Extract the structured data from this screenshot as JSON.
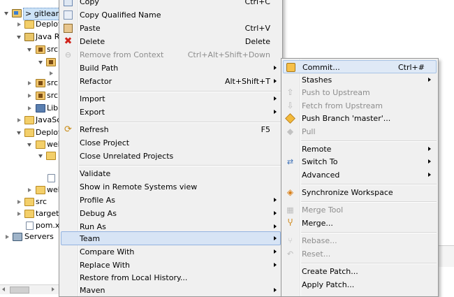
{
  "tree": {
    "items": [
      {
        "label": "> gitlearn",
        "icon": "project-icon",
        "selected": true
      },
      {
        "label": "Deploy",
        "icon": "deploy-icon"
      },
      {
        "label": "Java R",
        "icon": "java-resources-icon"
      },
      {
        "label": "src",
        "icon": "source-folder-icon"
      },
      {
        "label": "",
        "icon": "package-icon"
      },
      {
        "label": "",
        "icon": ""
      },
      {
        "label": "src",
        "icon": "source-folder-icon"
      },
      {
        "label": "src",
        "icon": "source-folder-icon"
      },
      {
        "label": "Lib",
        "icon": "library-icon"
      },
      {
        "label": "JavaSc",
        "icon": "javascript-icon"
      },
      {
        "label": "Deploy",
        "icon": "deploy-icon"
      },
      {
        "label": "web",
        "icon": "folder-icon"
      },
      {
        "label": "",
        "icon": "folder-icon"
      },
      {
        "label": "",
        "icon": "file-icon"
      },
      {
        "label": "web",
        "icon": "folder-icon"
      },
      {
        "label": "src",
        "icon": "folder-icon"
      },
      {
        "label": "target",
        "icon": "folder-icon"
      },
      {
        "label": "pom.x",
        "icon": "xml-file-icon"
      },
      {
        "label": "Servers",
        "icon": "servers-icon"
      }
    ]
  },
  "main_menu": {
    "items": [
      {
        "label": "Copy",
        "shortcut": "Ctrl+C",
        "icon": "copy-icon"
      },
      {
        "label": "Copy Qualified Name",
        "icon": "copy-qualified-icon"
      },
      {
        "label": "Paste",
        "shortcut": "Ctrl+V",
        "icon": "paste-icon"
      },
      {
        "label": "Delete",
        "shortcut": "Delete",
        "icon": "delete-icon"
      },
      {
        "label": "Remove from Context",
        "shortcut": "Ctrl+Alt+Shift+Down",
        "disabled": true,
        "icon": "remove-context-icon"
      },
      {
        "label": "Build Path",
        "submenu": true
      },
      {
        "label": "Refactor",
        "shortcut": "Alt+Shift+T",
        "submenu": true
      },
      {
        "label": "Import",
        "submenu": true
      },
      {
        "label": "Export",
        "submenu": true
      },
      {
        "label": "Refresh",
        "shortcut": "F5",
        "icon": "refresh-icon"
      },
      {
        "label": "Close Project"
      },
      {
        "label": "Close Unrelated Projects"
      },
      {
        "label": "Validate"
      },
      {
        "label": "Show in Remote Systems view"
      },
      {
        "label": "Profile As",
        "submenu": true
      },
      {
        "label": "Debug As",
        "submenu": true
      },
      {
        "label": "Run As",
        "submenu": true
      },
      {
        "label": "Team",
        "submenu": true,
        "highlighted": true
      },
      {
        "label": "Compare With",
        "submenu": true
      },
      {
        "label": "Replace With",
        "submenu": true
      },
      {
        "label": "Restore from Local History..."
      },
      {
        "label": "Maven",
        "submenu": true
      }
    ]
  },
  "team_menu": {
    "items": [
      {
        "label": "Commit...",
        "shortcut": "Ctrl+#",
        "icon": "commit-icon",
        "highlighted": true
      },
      {
        "label": "Stashes",
        "submenu": true
      },
      {
        "label": "Push to Upstream",
        "disabled": true,
        "icon": "push-upstream-icon"
      },
      {
        "label": "Fetch from Upstream",
        "disabled": true,
        "icon": "fetch-upstream-icon"
      },
      {
        "label": "Push Branch 'master'...",
        "icon": "push-branch-icon"
      },
      {
        "label": "Pull",
        "disabled": true,
        "icon": "pull-icon"
      },
      {
        "label": "Remote",
        "submenu": true
      },
      {
        "label": "Switch To",
        "submenu": true,
        "icon": "switch-to-icon"
      },
      {
        "label": "Advanced",
        "submenu": true
      },
      {
        "label": "Synchronize Workspace",
        "icon": "synchronize-icon"
      },
      {
        "label": "Merge Tool",
        "disabled": true,
        "icon": "merge-tool-icon"
      },
      {
        "label": "Merge...",
        "icon": "merge-icon"
      },
      {
        "label": "Rebase...",
        "disabled": true,
        "icon": "rebase-icon"
      },
      {
        "label": "Reset...",
        "disabled": true,
        "icon": "reset-icon"
      },
      {
        "label": "Create Patch..."
      },
      {
        "label": "Apply Patch..."
      }
    ]
  },
  "colors": {
    "menu_bg": "#f0f0f0",
    "highlight": "#dfe9f6",
    "disabled_text": "#8d8d8d"
  }
}
